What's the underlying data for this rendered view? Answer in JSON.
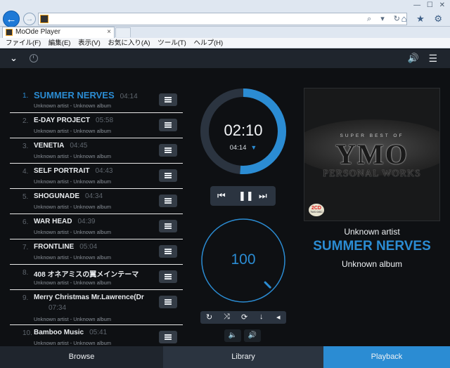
{
  "browser": {
    "tab_title": "MoOde Player",
    "tab_close": "×",
    "window_controls": "— ☐ ✕",
    "address_tools": "⌕ ▾ ↻",
    "toolbar_icons": "⌂ ★ ⚙",
    "menus": [
      "ファイル(F)",
      "編集(E)",
      "表示(V)",
      "お気に入り(A)",
      "ツール(T)",
      "ヘルプ(H)"
    ]
  },
  "header": {
    "chevron_icon": "chevron-down-icon",
    "clock_icon": "clock-icon",
    "volume_glyph": "🔊",
    "menu_glyph": "☰"
  },
  "playlist": [
    {
      "num": "1.",
      "title": "SUMMER NERVES",
      "time": "04:14",
      "sub": "Unknown artist - Unknown album",
      "active": true
    },
    {
      "num": "2.",
      "title": "E-DAY PROJECT",
      "time": "05:58",
      "sub": "Unknown artist - Unknown album"
    },
    {
      "num": "3.",
      "title": "VENETIA",
      "time": "04:45",
      "sub": "Unknown artist - Unknown album"
    },
    {
      "num": "4.",
      "title": "SELF PORTRAIT",
      "time": "04:43",
      "sub": "Unknown artist - Unknown album"
    },
    {
      "num": "5.",
      "title": "SHOGUNADE",
      "time": "04:34",
      "sub": "Unknown artist - Unknown album"
    },
    {
      "num": "6.",
      "title": "WAR HEAD",
      "time": "04:39",
      "sub": "Unknown artist - Unknown album"
    },
    {
      "num": "7.",
      "title": "FRONTLINE",
      "time": "05:04",
      "sub": "Unknown artist - Unknown album"
    },
    {
      "num": "8.",
      "title": "408 オネアミスの翼メインテーマ",
      "time": "",
      "sub": "Unknown artist - Unknown album"
    },
    {
      "num": "9.",
      "title": "Merry Christmas Mr.Lawrence(Dr",
      "time": "07:34",
      "sub": "Unknown artist - Unknown album",
      "tall": true
    },
    {
      "num": "10.",
      "title": "Bamboo Music",
      "time": "05:41",
      "sub": "Unknown artist - Unknown album"
    }
  ],
  "player": {
    "elapsed": "02:10",
    "total": "04:14",
    "total_caret": "▼",
    "progress": 0.512,
    "volume": "100",
    "volume_level": 1.0,
    "transport": {
      "prev": "⏮",
      "pause": "❚❚",
      "next": "⏭"
    },
    "controls": {
      "repeat": "↻",
      "shuffle": "⤨",
      "consume": "⟳",
      "download": "↓",
      "more": "◂"
    },
    "vol_down": "🔈",
    "vol_up": "🔊",
    "accent": "#2b8cd3"
  },
  "now_playing": {
    "artist": "Unknown artist",
    "title": "SUMMER NERVES",
    "album": "Unknown album",
    "cover": {
      "subtitle": "SUPER BEST OF",
      "logo": "YMO",
      "personal": "PERSONAL WORKS",
      "badge": "2CD",
      "badge_sub": "TWO DISC"
    }
  },
  "footer": {
    "browse": "Browse",
    "library": "Library",
    "playback": "Playback"
  }
}
